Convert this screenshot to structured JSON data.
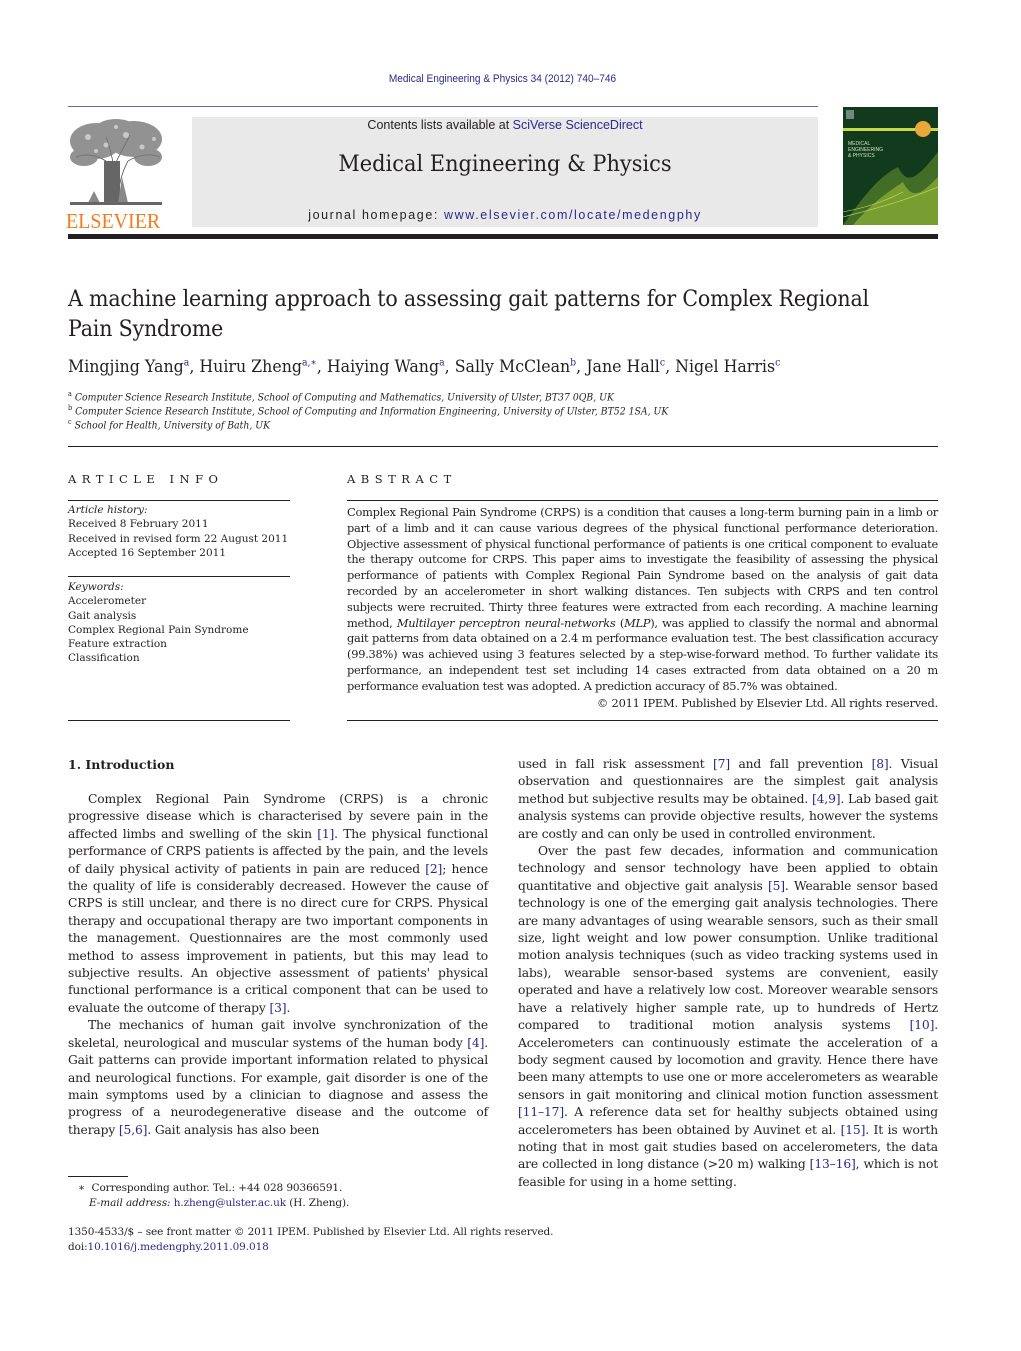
{
  "header": {
    "journal_reference": "Medical Engineering & Physics 34 (2012) 740–746",
    "contents_prefix": "Contents lists available at ",
    "contents_link": "SciVerse ScienceDirect",
    "journal_title": "Medical Engineering & Physics",
    "homepage_prefix": "journal homepage: ",
    "homepage_link": "www.elsevier.com/locate/medengphy",
    "publisher_logo_text": "ELSEVIER",
    "cover_title_lines": [
      "MEDICAL",
      "ENGINEERING",
      "& PHYSICS"
    ],
    "colors": {
      "elsevier_orange": "#f47b20",
      "link_blue": "#2a2a8a",
      "banner_gray": "#e9e9ea",
      "cover_green": "#123a1c",
      "cover_accent": "#c8d84a"
    }
  },
  "article": {
    "title": "A machine learning approach to assessing gait patterns for Complex Regional Pain Syndrome",
    "authors": [
      {
        "name": "Mingjing Yang",
        "sup": "a"
      },
      {
        "name": "Huiru Zheng",
        "sup": "a,∗"
      },
      {
        "name": "Haiying Wang",
        "sup": "a"
      },
      {
        "name": "Sally McClean",
        "sup": "b"
      },
      {
        "name": "Jane Hall",
        "sup": "c"
      },
      {
        "name": "Nigel Harris",
        "sup": "c"
      }
    ],
    "affiliations": [
      {
        "mark": "a",
        "text": "Computer Science Research Institute, School of Computing and Mathematics, University of Ulster, BT37 0QB, UK"
      },
      {
        "mark": "b",
        "text": "Computer Science Research Institute, School of Computing and Information Engineering, University of Ulster, BT52 1SA, UK"
      },
      {
        "mark": "c",
        "text": "School for Health, University of Bath, UK"
      }
    ]
  },
  "article_info": {
    "heading": "ARTICLE INFO",
    "history_label": "Article history:",
    "history": [
      "Received 8 February 2011",
      "Received in revised form 22 August 2011",
      "Accepted 16 September 2011"
    ],
    "keywords_label": "Keywords:",
    "keywords": [
      "Accelerometer",
      "Gait analysis",
      "Complex Regional Pain Syndrome",
      "Feature extraction",
      "Classification"
    ]
  },
  "abstract": {
    "heading": "ABSTRACT",
    "text_1": "Complex Regional Pain Syndrome (CRPS) is a condition that causes a long-term burning pain in a limb or part of a limb and it can cause various degrees of the physical functional performance deterioration. Objective assessment of physical functional performance of patients is one critical component to evaluate the therapy outcome for CRPS. This paper aims to investigate the feasibility of assessing the physical performance of patients with Complex Regional Pain Syndrome based on the analysis of gait data recorded by an accelerometer in short walking distances. Ten subjects with CRPS and ten control subjects were recruited. Thirty three features were extracted from each recording. A machine learning method, ",
    "text_italic": "Multilayer perceptron neural-networks",
    "text_2": " (",
    "text_italic_2": "MLP",
    "text_3": "), was applied to classify the normal and abnormal gait patterns from data obtained on a 2.4 m performance evaluation test. The best classification accuracy (99.38%) was achieved using 3 features selected by a step-wise-forward method. To further validate its performance, an independent test set including 14 cases extracted from data obtained on a 20 m performance evaluation test was adopted. A prediction accuracy of 85.7% was obtained.",
    "copyright": "© 2011 IPEM. Published by Elsevier Ltd. All rights reserved."
  },
  "introduction": {
    "heading": "1.  Introduction",
    "left_column": [
      [
        {
          "t": "Complex Regional Pain Syndrome (CRPS) is a chronic progressive disease which is characterised by severe pain in the affected limbs and swelling of the skin "
        },
        {
          "c": "[1]"
        },
        {
          "t": ". The physical functional performance of CRPS patients is affected by the pain, and the levels of daily physical activity of patients in pain are reduced "
        },
        {
          "c": "[2]"
        },
        {
          "t": "; hence the quality of life is considerably decreased. However the cause of CRPS is still unclear, and there is no direct cure for CRPS. Physical therapy and occupational therapy are two important components in the management. Questionnaires are the most commonly used method to assess improvement in patients, but this may lead to subjective results. An objective assessment of patients' physical functional performance is a critical component that can be used to evaluate the outcome of therapy "
        },
        {
          "c": "[3]"
        },
        {
          "t": "."
        }
      ],
      [
        {
          "t": "The mechanics of human gait involve synchronization of the skeletal, neurological and muscular systems of the human body "
        },
        {
          "c": "[4]"
        },
        {
          "t": ". Gait patterns can provide important information related to physical and neurological functions. For example, gait disorder is one of the main symptoms used by a clinician to diagnose and assess the progress of a neurodegenerative disease and the outcome of therapy "
        },
        {
          "c": "[5,6]"
        },
        {
          "t": ". Gait analysis has also been"
        }
      ]
    ],
    "right_column": [
      [
        {
          "t": "used in fall risk assessment "
        },
        {
          "c": "[7]"
        },
        {
          "t": " and fall prevention "
        },
        {
          "c": "[8]"
        },
        {
          "t": ". Visual observation and questionnaires are the simplest gait analysis method but subjective results may be obtained. "
        },
        {
          "c": "[4,9]"
        },
        {
          "t": ". Lab based gait analysis systems can provide objective results, however the systems are costly and can only be used in controlled environment."
        }
      ],
      [
        {
          "t": "Over the past few decades, information and communication technology and sensor technology have been applied to obtain quantitative and objective gait analysis "
        },
        {
          "c": "[5]"
        },
        {
          "t": ". Wearable sensor based technology is one of the emerging gait analysis technologies. There are many advantages of using wearable sensors, such as their small size, light weight and low power consumption. Unlike traditional motion analysis techniques (such as video tracking systems used in labs), wearable sensor-based systems are convenient, easily operated and have a relatively low cost. Moreover wearable sensors have a relatively higher sample rate, up to hundreds of Hertz compared to traditional motion analysis systems "
        },
        {
          "c": "[10]"
        },
        {
          "t": ". Accelerometers can continuously estimate the acceleration of a body segment caused by locomotion and gravity. Hence there have been many attempts to use one or more accelerometers as wearable sensors in gait monitoring and clinical motion function assessment "
        },
        {
          "c": "[11–17]"
        },
        {
          "t": ". A reference data set for healthy subjects obtained using accelerometers has been obtained by Auvinet et al. "
        },
        {
          "c": "[15]"
        },
        {
          "t": ". It is worth noting that in most gait studies based on accelerometers, the data are collected in long distance (>20 m) walking "
        },
        {
          "c": "[13–16]"
        },
        {
          "t": ", which is not feasible for using in a home setting."
        }
      ]
    ]
  },
  "footnotes": {
    "corresponding_mark": "∗",
    "corresponding": "Corresponding author. Tel.: +44 028 90366591.",
    "email_label": "E-mail address:",
    "email": "h.zheng@ulster.ac.uk",
    "email_suffix": " (H. Zheng).",
    "front_matter": "1350-4533/$ – see front matter © 2011 IPEM. Published by Elsevier Ltd. All rights reserved.",
    "doi_prefix": "doi:",
    "doi": "10.1016/j.medengphy.2011.09.018"
  }
}
